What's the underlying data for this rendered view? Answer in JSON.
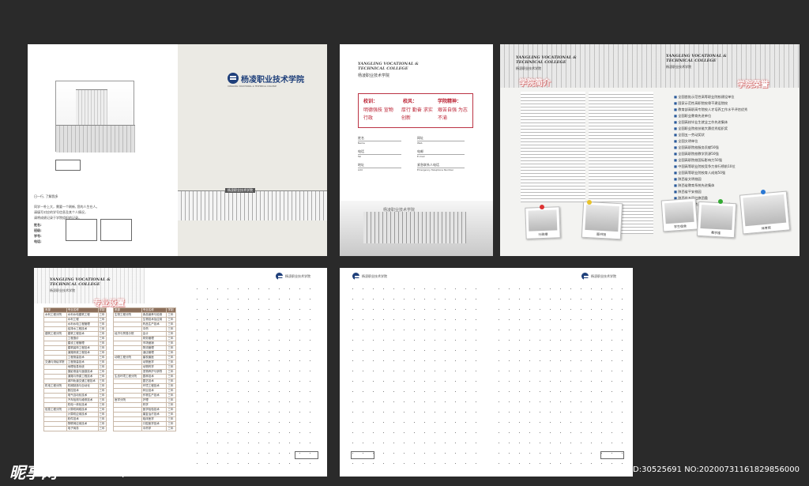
{
  "cover": {
    "school_name": "杨凌职业技术学院",
    "school_name_en": "YANGLING VOCATIONAL & TECHNICAL COLLEGE",
    "form_title": "日一行, 了解我多",
    "form_text_1": "同学一朴上大，需要一个刷新, 您的人生在人。",
    "form_text_2": "请填写对应的学号信息及其个人情况，",
    "form_text_3": "请将成绩记录于学院组织的记录。",
    "form_labels": [
      "姓名:",
      "班级:",
      "学号:",
      "电话:"
    ],
    "building_sign": "杨凌职业技术学院"
  },
  "card": {
    "school_name_en": "YANGLING VOCATIONAL & TECHNICAL COLLEGE",
    "school_name": "杨凌职业技术学院",
    "motto_heads": [
      "校训：",
      "校风：",
      "学院精神："
    ],
    "motto_lines": [
      "明德强技  宣物行政",
      "厚行  勤奋  求实  创新",
      "艰苦自强  为志不渝"
    ],
    "fields": [
      {
        "cn": "姓名",
        "en": "Name"
      },
      {
        "cn": "网址",
        "en": "Web"
      },
      {
        "cn": "电话",
        "en": "Tel"
      },
      {
        "cn": "电邮",
        "en": "E-mail"
      },
      {
        "cn": "地址",
        "en": "Add"
      },
      {
        "cn": "紧急联系人电话",
        "en": "Emergency Telephone Number"
      }
    ],
    "building_sign": "杨凌职业技术学院"
  },
  "intro": {
    "school_name_en": "YANGLING VOCATIONAL & TECHNICAL COLLEGE",
    "school_name": "杨凌职业技术学院",
    "title_left": "学院简介",
    "title_right": "学院荣誉",
    "honors": [
      "全国首批示范性高等职业院校建设单位",
      "国家示范性高职院校骨干建设院校",
      "教育部高职高专院校人才培养工作水平评估优秀",
      "全国职业教育先进单位",
      "全国高校毕业生就业工作先进集体",
      "全国职业院校技能大赛优秀组织奖",
      "全国五一劳动奖状",
      "全国文明单位",
      "全国高职院校服务贡献50强",
      "全国高职院校教学资源50强",
      "全国高职院校国际影响力50强",
      "中国高等职业院校竞争力排行榜前10位",
      "全国高等职业院校育人成效50强",
      "陕西省文明校园",
      "陕西省教育系统先进集体",
      "陕西省平安校园",
      "陕西省五四红旗团委",
      "陕西省示范性高等职业院校建设单位"
    ],
    "photos": [
      "行政楼",
      "图书馆",
      "学生宿舍",
      "教学楼",
      "体育馆"
    ]
  },
  "majors": {
    "school_name_en": "YANGLING VOCATIONAL & TECHNICAL COLLEGE",
    "school_name": "杨凌职业技术学院",
    "title": "专业设置",
    "table_headers": [
      "系部",
      "专业名称",
      "学制"
    ],
    "table_rows": [
      [
        "水利工程分院",
        "水利水电建筑工程",
        "三年"
      ],
      [
        "",
        "水利工程",
        "三年"
      ],
      [
        "",
        "水利水电工程管理",
        "三年"
      ],
      [
        "",
        "给排水工程技术",
        "三年"
      ],
      [
        "建筑工程分院",
        "建筑工程技术",
        "三年"
      ],
      [
        "",
        "工程造价",
        "三年"
      ],
      [
        "",
        "建设工程管理",
        "三年"
      ],
      [
        "",
        "建筑装饰工程技术",
        "三年"
      ],
      [
        "",
        "道路桥梁工程技术",
        "三年"
      ],
      [
        "",
        "工程测量技术",
        "三年"
      ],
      [
        "交通与测绘学院",
        "工程测量技术",
        "三年"
      ],
      [
        "",
        "地理信息系统",
        "三年"
      ],
      [
        "",
        "摄影测量与遥感技术",
        "三年"
      ],
      [
        "",
        "道路与桥梁工程技术",
        "三年"
      ],
      [
        "",
        "城市轨道交通工程技术",
        "三年"
      ],
      [
        "机电工程分院",
        "机械制造与自动化",
        "三年"
      ],
      [
        "",
        "数控技术",
        "三年"
      ],
      [
        "",
        "电气自动化技术",
        "三年"
      ],
      [
        "",
        "汽车检测与维修技术",
        "三年"
      ],
      [
        "",
        "机电一体化技术",
        "三年"
      ],
      [
        "信息工程分院",
        "计算机网络技术",
        "三年"
      ],
      [
        "",
        "计算机应用技术",
        "三年"
      ],
      [
        "",
        "软件技术",
        "三年"
      ],
      [
        "",
        "物联网应用技术",
        "三年"
      ],
      [
        "",
        "电子商务",
        "三年"
      ]
    ],
    "table2_headers": [
      "系部",
      "专业名称",
      "学制"
    ],
    "table2_rows": [
      [
        "生物工程分院",
        "食品营养与检测",
        "三年"
      ],
      [
        "",
        "生物技术及应用",
        "三年"
      ],
      [
        "",
        "药品生产技术",
        "三年"
      ],
      [
        "",
        "中药",
        "三年"
      ],
      [
        "经济与贸易分院",
        "会计",
        "三年"
      ],
      [
        "",
        "财务管理",
        "三年"
      ],
      [
        "",
        "市场营销",
        "三年"
      ],
      [
        "",
        "物流管理",
        "三年"
      ],
      [
        "",
        "酒店管理",
        "三年"
      ],
      [
        "动物工程分院",
        "畜牧兽医",
        "三年"
      ],
      [
        "",
        "动物医学",
        "三年"
      ],
      [
        "",
        "动物药学",
        "三年"
      ],
      [
        "",
        "宠物养护与驯导",
        "三年"
      ],
      [
        "生态环境工程分院",
        "园林技术",
        "三年"
      ],
      [
        "",
        "园艺技术",
        "三年"
      ],
      [
        "",
        "环境工程技术",
        "三年"
      ],
      [
        "",
        "林业技术",
        "三年"
      ],
      [
        "",
        "作物生产技术",
        "三年"
      ],
      [
        "医学分院",
        "护理",
        "三年"
      ],
      [
        "",
        "药学",
        "三年"
      ],
      [
        "",
        "医学检验技术",
        "三年"
      ],
      [
        "",
        "康复治疗技术",
        "三年"
      ],
      [
        "",
        "临床医学",
        "三年"
      ],
      [
        "",
        "口腔医学技术",
        "三年"
      ],
      [
        "",
        "中药学",
        "三年"
      ]
    ],
    "right_header": "杨凌职业技术学院"
  },
  "notes": {
    "left_header": "杨凌职业技术学院",
    "right_header": "杨凌职业技术学院"
  },
  "watermark": {
    "logo": "昵享网",
    "url": "www.nipic.com",
    "id_text": "ID:30525691 NO:20200731161829856000"
  }
}
